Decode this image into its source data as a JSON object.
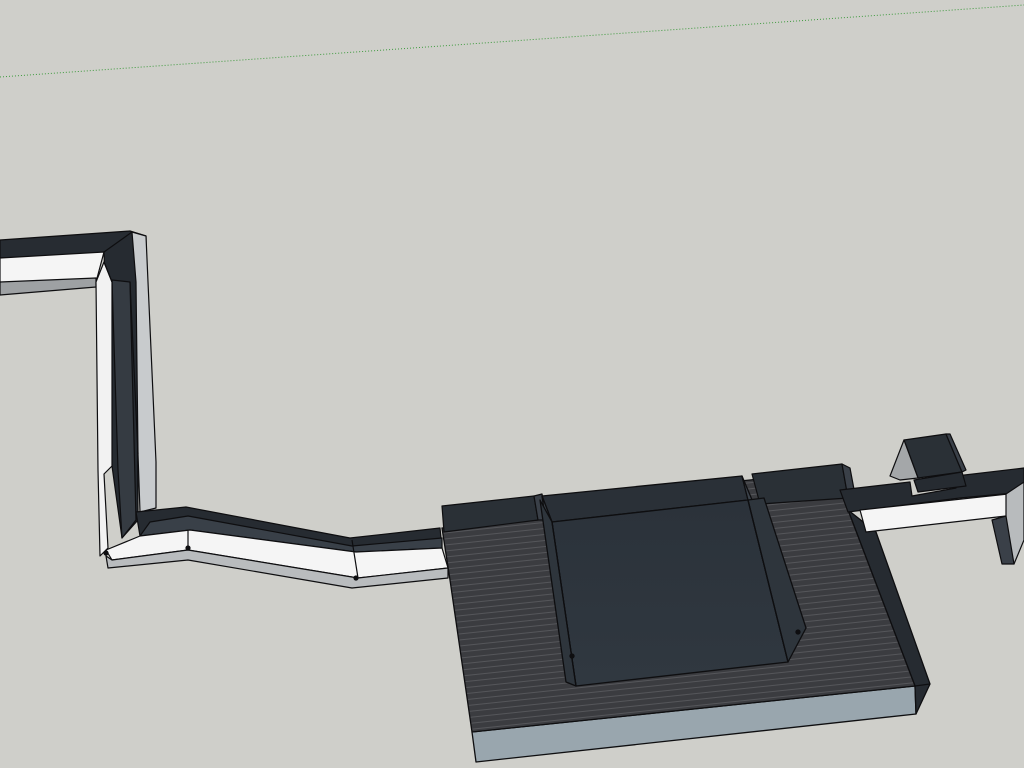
{
  "viewport": {
    "colors": {
      "background": "#cfcfca",
      "axis_green": "#3e9a3e",
      "top_face": "#f4f4f4",
      "side_dark": "#262b31",
      "side_mid": "#3a4048",
      "side_light": "#c9ccce",
      "deck": "#3b3c40",
      "deck_line": "#5a5b5e",
      "pool_water": "#2c343c",
      "pool_bottom_edge": "#95a2aa",
      "outline": "#0e0e10"
    }
  }
}
